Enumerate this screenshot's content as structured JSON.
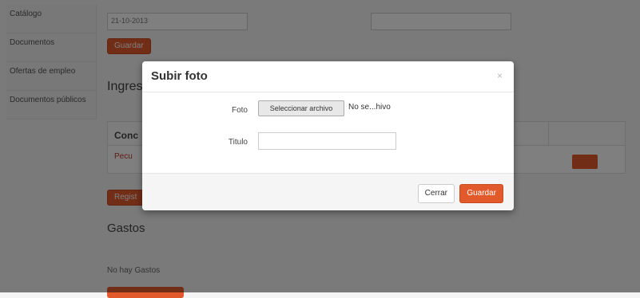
{
  "sidebar": {
    "items": [
      {
        "label": "Catálogo"
      },
      {
        "label": "Documentos"
      },
      {
        "label": "Ofertas de empleo"
      },
      {
        "label": "Documentos públicos"
      }
    ]
  },
  "main": {
    "date_value": "21-10-2013",
    "guardar_label": "Guardar",
    "ingresos_heading": "Ingres",
    "table_header": "Conc",
    "table_row_text": "Pecu",
    "registrar_label": "Regist",
    "gastos_heading": "Gastos",
    "no_gastos_text": "No hay Gastos"
  },
  "modal": {
    "title": "Subir foto",
    "close_symbol": "×",
    "foto_label": "Foto",
    "file_button_label": "Seleccionar archivo",
    "file_status": "No se...hivo",
    "titulo_label": "Titulo",
    "titulo_value": "",
    "cerrar_label": "Cerrar",
    "guardar_label": "Guardar"
  },
  "colors": {
    "accent": "#e25a2b",
    "backdrop": "#000000"
  }
}
